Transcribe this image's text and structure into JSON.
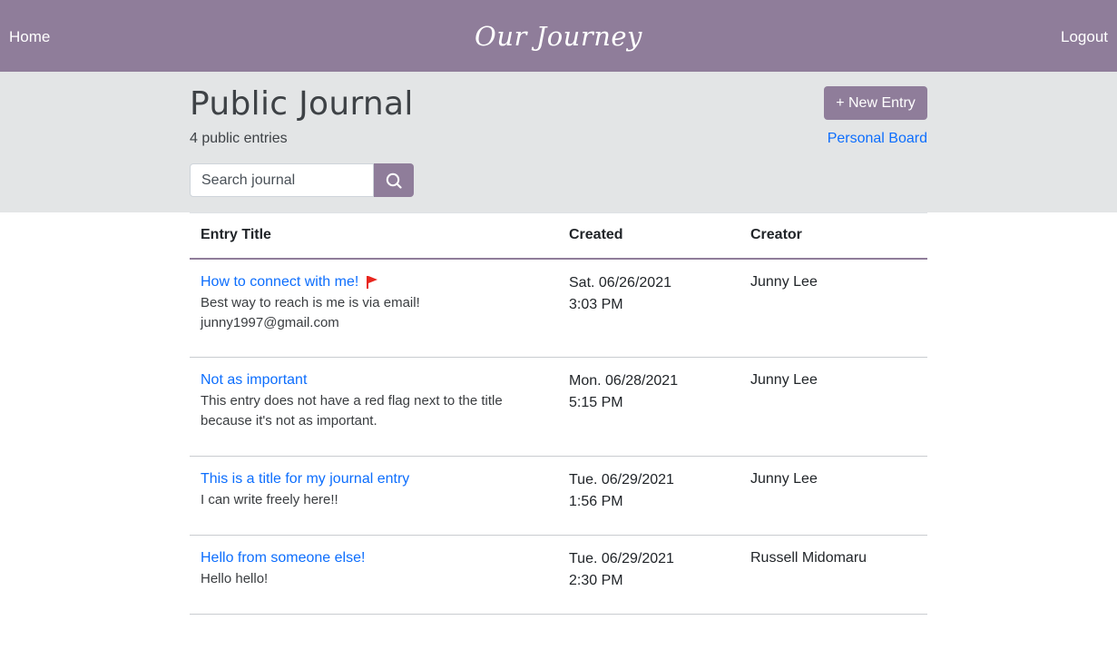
{
  "nav": {
    "home": "Home",
    "brand": "Our Journey",
    "logout": "Logout"
  },
  "header": {
    "title": "Public Journal",
    "count": "4 public entries",
    "new_entry": "+ New Entry",
    "personal_board": "Personal Board"
  },
  "search": {
    "placeholder": "Search journal",
    "value": ""
  },
  "table": {
    "headers": [
      "Entry Title",
      "Created",
      "Creator"
    ],
    "rows": [
      {
        "title": "How to connect with me!",
        "flagged": true,
        "description": "Best way to reach is me is via email! junny1997@gmail.com",
        "date": "Sat. 06/26/2021",
        "time": "3:03 PM",
        "creator": "Junny Lee"
      },
      {
        "title": "Not as important",
        "flagged": false,
        "description": "This entry does not have a red flag next to the title because it's not as important.",
        "date": "Mon. 06/28/2021",
        "time": "5:15 PM",
        "creator": "Junny Lee"
      },
      {
        "title": "This is a title for my journal entry",
        "flagged": false,
        "description": "I can write freely here!!",
        "date": "Tue. 06/29/2021",
        "time": "1:56 PM",
        "creator": "Junny Lee"
      },
      {
        "title": "Hello from someone else!",
        "flagged": false,
        "description": "Hello hello!",
        "date": "Tue. 06/29/2021",
        "time": "2:30 PM",
        "creator": "Russell Midomaru"
      }
    ]
  },
  "icons": {
    "search": "search-icon",
    "flag": "flag-icon"
  },
  "colors": {
    "brand": "#8f7d9a",
    "band": "#e3e5e6",
    "link": "#0d6efd",
    "flag": "#e8261e"
  }
}
